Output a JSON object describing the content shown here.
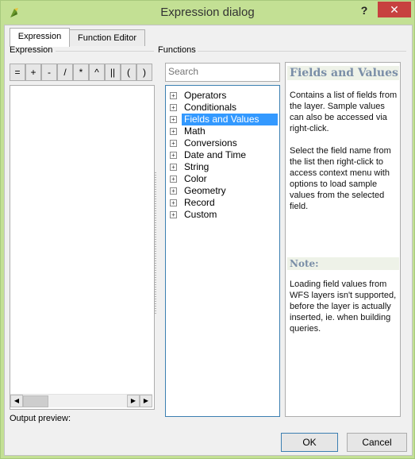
{
  "window": {
    "title": "Expression dialog",
    "help_label": "?",
    "close_label": "✕"
  },
  "tabs": [
    {
      "label": "Expression",
      "active": true
    },
    {
      "label": "Function Editor",
      "active": false
    }
  ],
  "expression_panel": {
    "group_label": "Expression",
    "operators": [
      "=",
      "+",
      "-",
      "/",
      "*",
      "^",
      "||",
      "(",
      ")"
    ],
    "editor_text": "",
    "output_preview_label": "Output preview:"
  },
  "functions_panel": {
    "group_label": "Functions",
    "search_placeholder": "Search",
    "items": [
      {
        "label": "Operators"
      },
      {
        "label": "Conditionals"
      },
      {
        "label": "Fields and Values",
        "selected": true
      },
      {
        "label": "Math"
      },
      {
        "label": "Conversions"
      },
      {
        "label": "Date and Time"
      },
      {
        "label": "String"
      },
      {
        "label": "Color"
      },
      {
        "label": "Geometry"
      },
      {
        "label": "Record"
      },
      {
        "label": "Custom"
      }
    ],
    "expander_glyph": "+"
  },
  "help": {
    "title": "Fields and Values",
    "paragraph1": "Contains a list of fields from the layer. Sample values can also be accessed via right-click.",
    "paragraph2": "Select the field name from the list then right-click to access context menu with options to load sample values from the selected field.",
    "note_title": "Note:",
    "note_text": "Loading field values from WFS layers isn't supported, before the layer is actually inserted, ie. when building queries."
  },
  "buttons": {
    "ok": "OK",
    "cancel": "Cancel"
  },
  "scrollbar": {
    "left_arrow": "◀",
    "right_arrow": "▶"
  },
  "colors": {
    "titlebar": "#c3e094",
    "close_button": "#c7413f",
    "selection": "#3399ff",
    "help_heading": "#7a8ea7"
  }
}
